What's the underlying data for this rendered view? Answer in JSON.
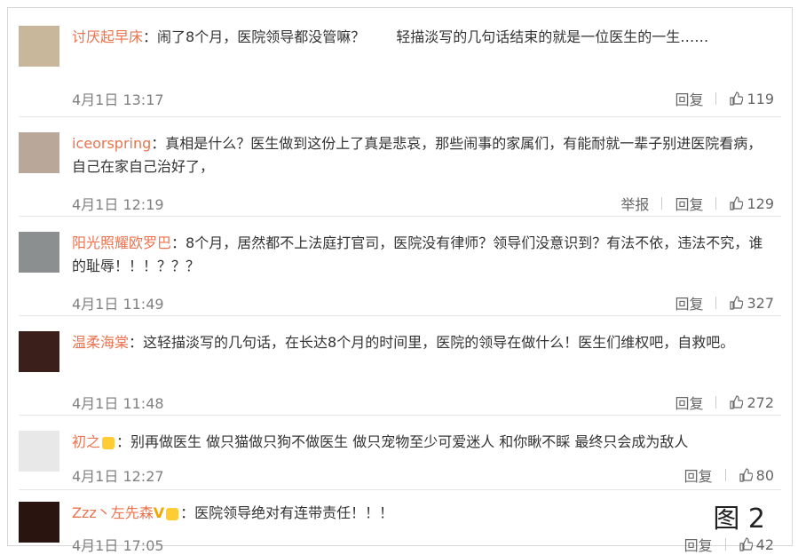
{
  "comments": [
    {
      "name": "讨厌起早床",
      "text": "：闹了8个月，医院领导都没管嘛？",
      "extra": "轻描淡写的几句话结束的就是一位医生的一生……",
      "time": "4月1日 13:17",
      "reply": "回复",
      "like_count": "119"
    },
    {
      "name": "iceorspring",
      "text": "：真相是什么？医生做到这份上了真是悲哀，那些闹事的家属们，有能耐就一辈子别进医院看病，自己在家自己治好了，",
      "time": "4月1日 12:19",
      "report": "举报",
      "reply": "回复",
      "like_count": "129"
    },
    {
      "name": "阳光照耀欧罗巴",
      "text": "：8个月，居然都不上法庭打官司，医院没有律师？领导们没意识到？有法不依，违法不究，谁的耻辱！！！？？？",
      "time": "4月1日 11:49",
      "reply": "回复",
      "like_count": "327"
    },
    {
      "name": "温柔海棠",
      "text": "：这轻描淡写的几句话，在长达8个月的时间里，医院的领导在做什么！医生们维权吧，自救吧。",
      "time": "4月1日 11:48",
      "reply": "回复",
      "like_count": "272"
    },
    {
      "name": "初之",
      "text": "：别再做医生 做只猫做只狗不做医生 做只宠物至少可爱迷人 和你瞅不睬 最终只会成为敌人",
      "time": "4月1日 12:27",
      "reply": "回复",
      "like_count": "80"
    },
    {
      "name": "Zzz丶左先森",
      "text": "：医院领导绝对有连带责任！！！",
      "time": "4月1日 17:05",
      "reply": "回复",
      "like_count": "42"
    }
  ],
  "figure_label": "图 2"
}
